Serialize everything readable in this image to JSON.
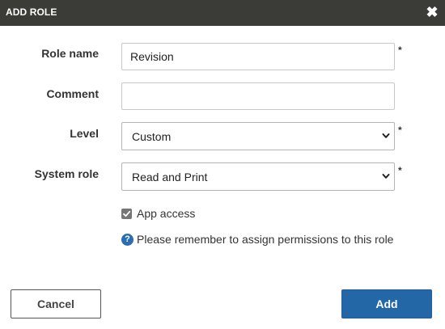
{
  "dialog": {
    "title": "ADD ROLE",
    "close_icon": "close-icon"
  },
  "form": {
    "role_name": {
      "label": "Role name",
      "value": "Revision",
      "required_mark": "*"
    },
    "comment": {
      "label": "Comment",
      "value": ""
    },
    "level": {
      "label": "Level",
      "selected": "Custom",
      "required_mark": "*"
    },
    "system_role": {
      "label": "System role",
      "selected": "Read and Print",
      "required_mark": "*"
    },
    "app_access": {
      "label": "App access",
      "checked": true
    },
    "help": {
      "icon": "question-circle-icon",
      "text": "Please remember to assign permissions to this role"
    }
  },
  "buttons": {
    "cancel_label": "Cancel",
    "add_label": "Add"
  },
  "colors": {
    "header_bg": "#3b3b38",
    "primary": "#2467a6",
    "help_icon": "#2a6db0"
  }
}
